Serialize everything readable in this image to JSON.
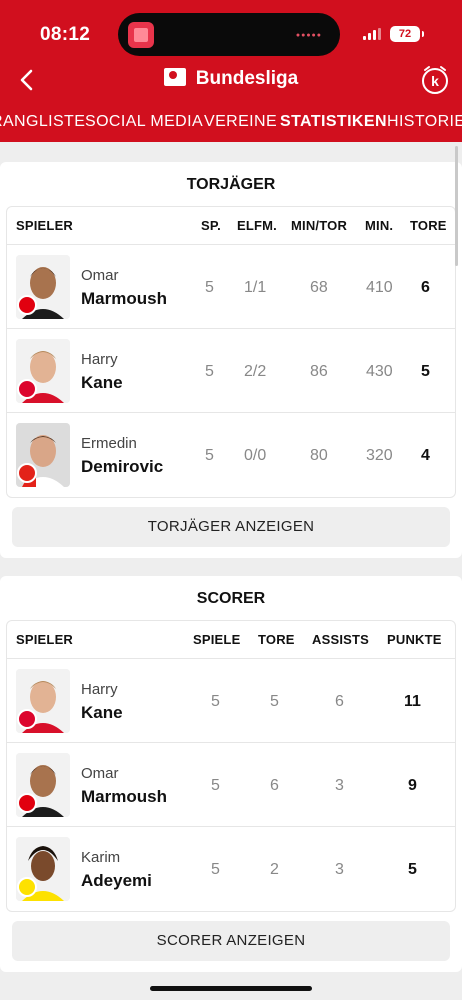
{
  "status": {
    "time": "08:12",
    "battery": "72"
  },
  "header": {
    "title": "Bundesliga"
  },
  "tabs": [
    {
      "label": "RANGLISTE"
    },
    {
      "label": "SOCIAL MEDIA"
    },
    {
      "label": "VEREINE"
    },
    {
      "label": "STATISTIKEN"
    },
    {
      "label": "HISTORIE"
    }
  ],
  "torjaeger": {
    "title": "TORJÄGER",
    "headers": [
      "SPIELER",
      "SP.",
      "ELFM.",
      "MIN/TOR",
      "MIN.",
      "TORE"
    ],
    "rows": [
      {
        "first": "Omar",
        "last": "Marmoush",
        "club_color": "#e1000f",
        "sp": "5",
        "elfm": "1/1",
        "min_tor": "68",
        "min": "410",
        "tore": "6"
      },
      {
        "first": "Harry",
        "last": "Kane",
        "club_color": "#dc052d",
        "sp": "5",
        "elfm": "2/2",
        "min_tor": "86",
        "min": "430",
        "tore": "5"
      },
      {
        "first": "Ermedin",
        "last": "Demirovic",
        "club_color": "#e32219",
        "sp": "5",
        "elfm": "0/0",
        "min_tor": "80",
        "min": "320",
        "tore": "4"
      }
    ],
    "button": "TORJÄGER ANZEIGEN"
  },
  "scorer": {
    "title": "SCORER",
    "headers": [
      "SPIELER",
      "SPIELE",
      "TORE",
      "ASSISTS",
      "PUNKTE"
    ],
    "rows": [
      {
        "first": "Harry",
        "last": "Kane",
        "club_color": "#dc052d",
        "spiele": "5",
        "tore": "5",
        "assists": "6",
        "punkte": "11"
      },
      {
        "first": "Omar",
        "last": "Marmoush",
        "club_color": "#e1000f",
        "spiele": "5",
        "tore": "6",
        "assists": "3",
        "punkte": "9"
      },
      {
        "first": "Karim",
        "last": "Adeyemi",
        "club_color": "#fde100",
        "spiele": "5",
        "tore": "2",
        "assists": "3",
        "punkte": "5"
      }
    ],
    "button": "SCORER ANZEIGEN"
  },
  "colors": {
    "brand": "#d10f1e",
    "background": "#eeeeee"
  }
}
